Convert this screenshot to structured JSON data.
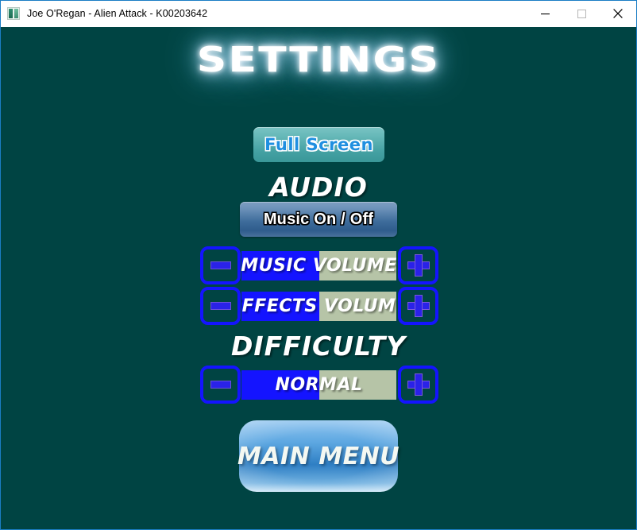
{
  "window": {
    "title": "Joe O'Regan - Alien Attack - K00203642",
    "icon": "app-icon",
    "controls": {
      "minimize": "minimize-icon",
      "maximize": "maximize-icon",
      "close": "close-icon"
    }
  },
  "screen": {
    "heading": "SETTINGS",
    "background_color": "#004443",
    "fullscreen_button": "Full Screen",
    "audio": {
      "label": "AUDIO",
      "music_toggle": "Music On / Off",
      "sliders": [
        {
          "id": "music-volume",
          "label": "MUSIC VOLUME",
          "fill_percent": 50,
          "decrease": "minus-icon",
          "increase": "plus-icon"
        },
        {
          "id": "effects-volume",
          "label": "EFFECTS VOLUME",
          "fill_percent": 50,
          "decrease": "minus-icon",
          "increase": "plus-icon"
        }
      ]
    },
    "difficulty": {
      "label": "DIFFICULTY",
      "slider": {
        "id": "difficulty-level",
        "label": "NORMAL",
        "fill_percent": 50,
        "decrease": "minus-icon",
        "increase": "plus-icon"
      }
    },
    "main_menu_button": "MAIN MENU"
  },
  "colors": {
    "fill_blue": "#1414ff",
    "track_green": "#b6c4a7",
    "background_teal": "#004443",
    "window_border": "#1a7dc4"
  }
}
